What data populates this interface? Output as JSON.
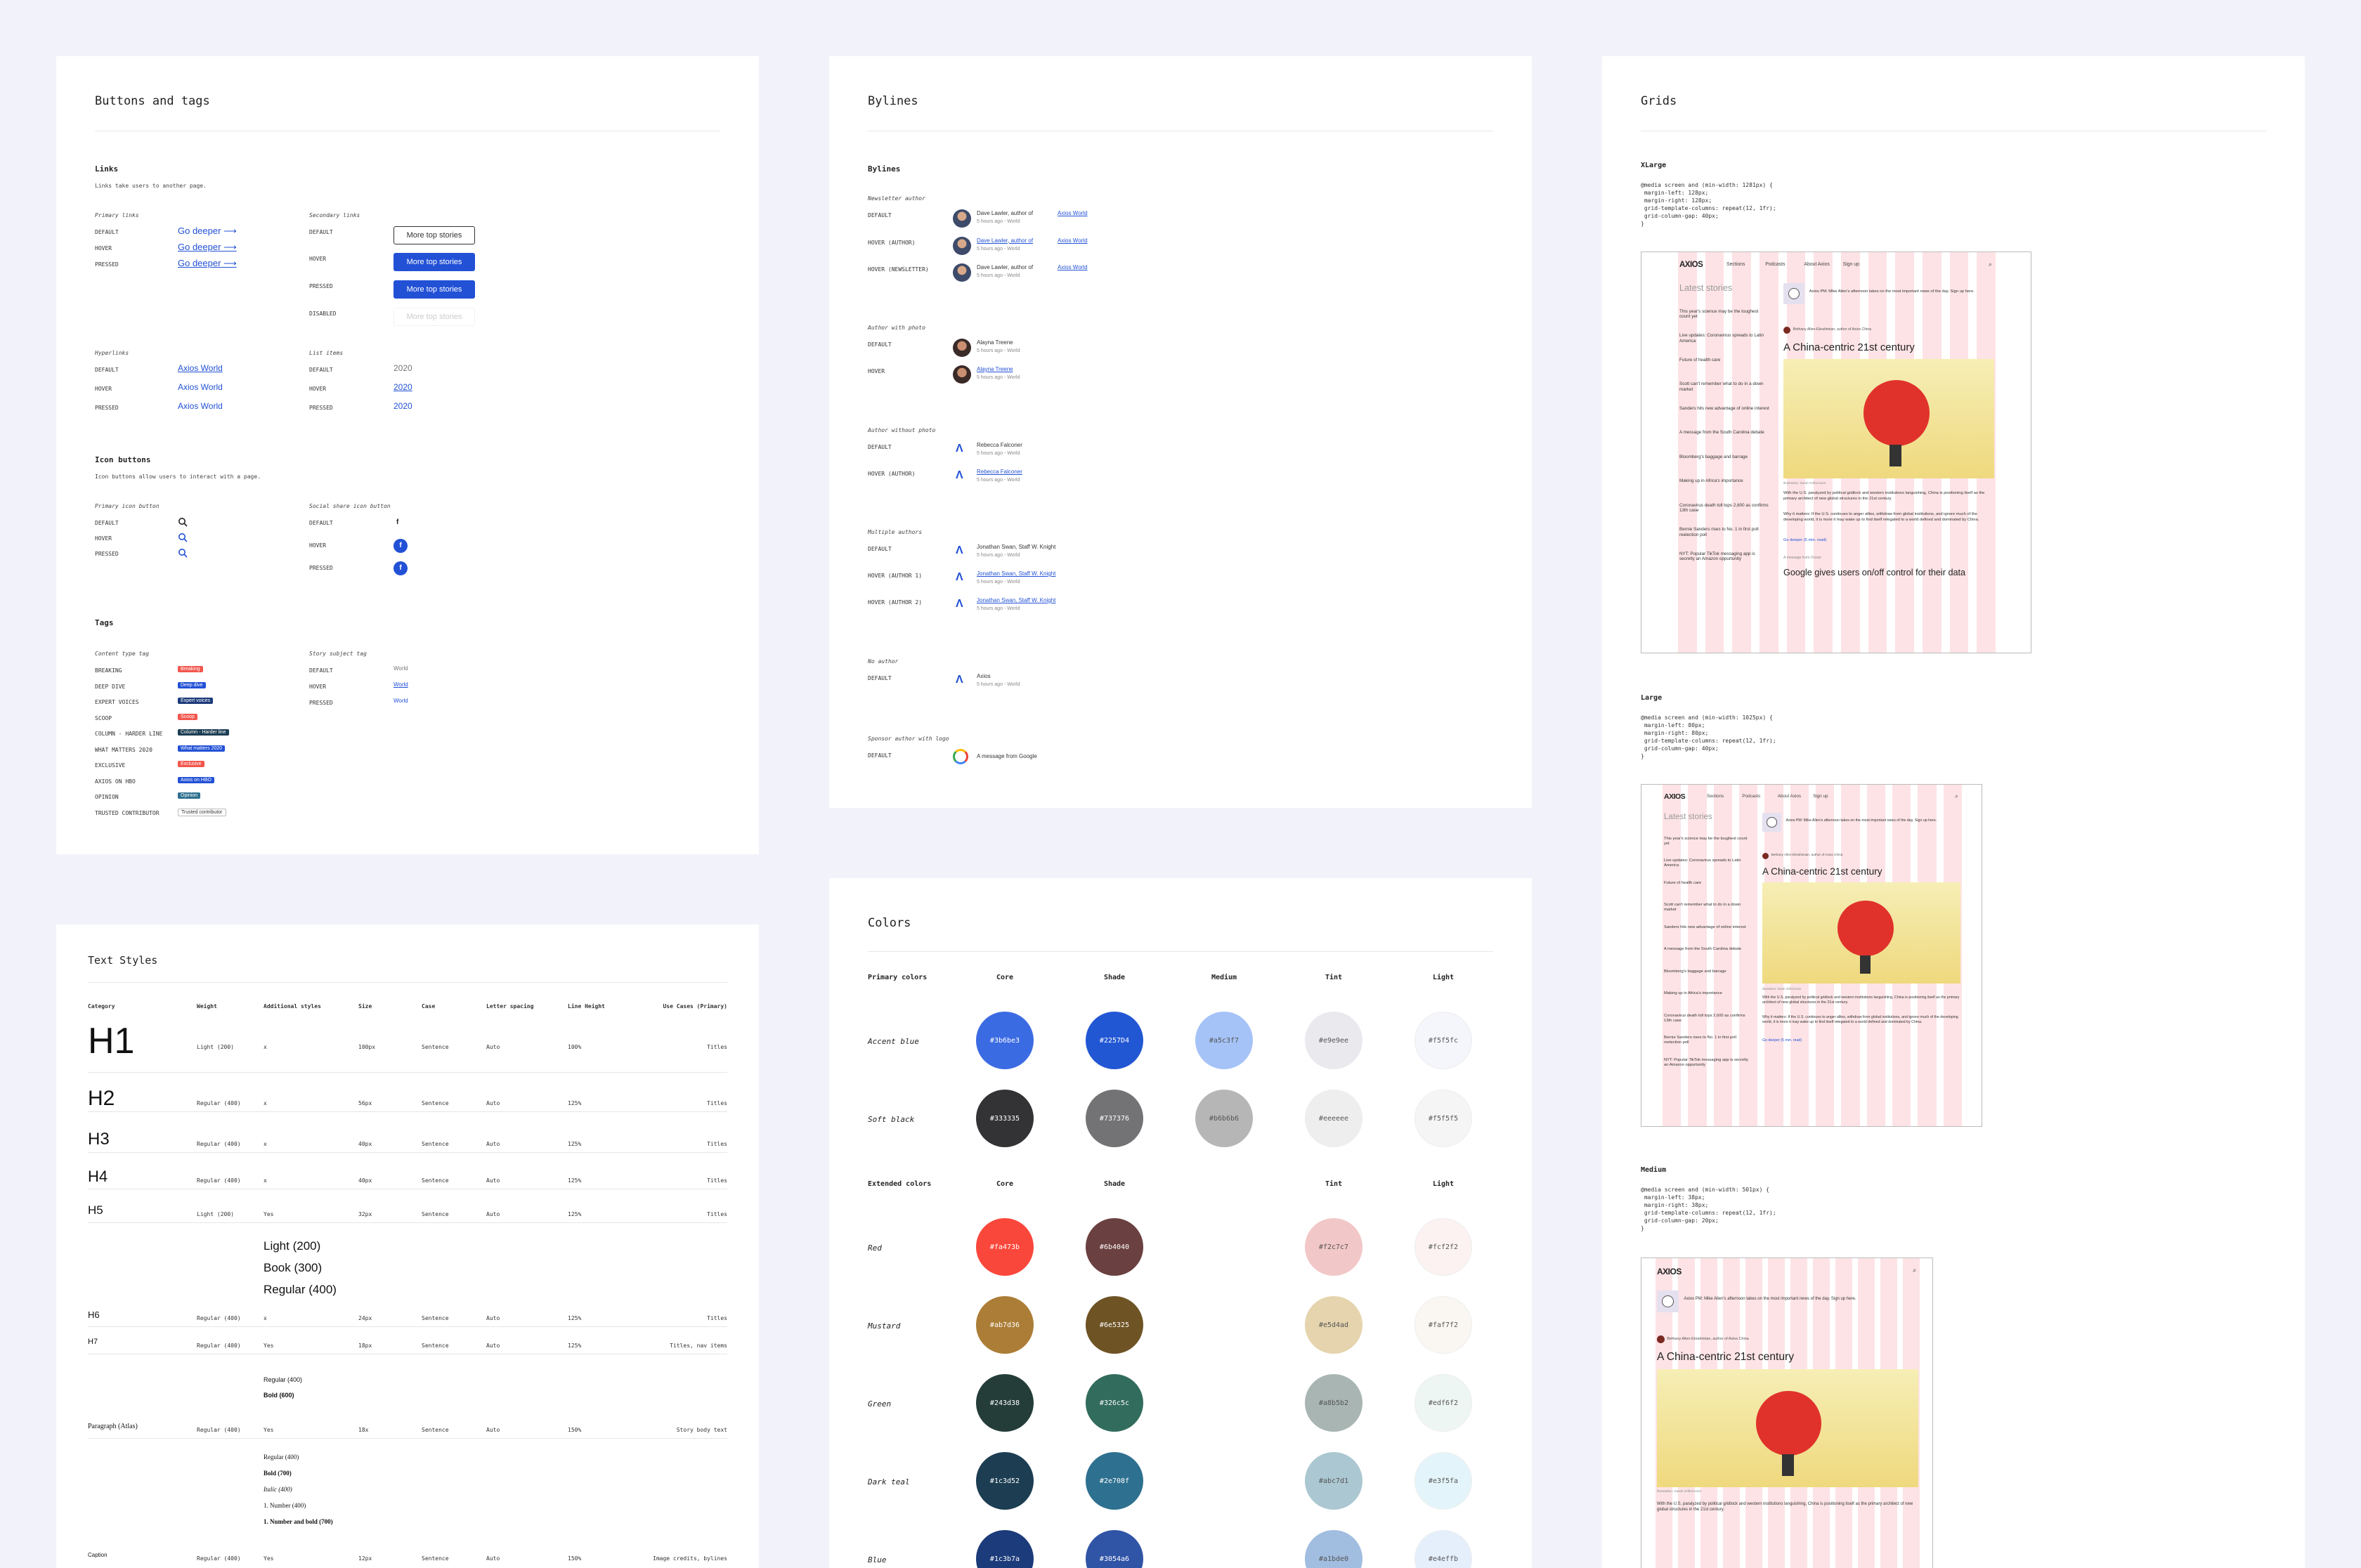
{
  "buttons_tags": {
    "title": "Buttons and tags",
    "links": {
      "heading": "Links",
      "desc": "Links take users to another page.",
      "primary": {
        "heading": "Primary links",
        "link_text": "Go deeper",
        "states": [
          "DEFAULT",
          "HOVER",
          "PRESSED"
        ]
      },
      "secondary": {
        "heading": "Secondary links",
        "button_text": "More top stories",
        "states": [
          "DEFAULT",
          "HOVER",
          "PRESSED",
          "DISABLED"
        ]
      },
      "hyper": {
        "heading": "Hyperlinks",
        "link_text": "Axios World",
        "states": [
          "DEFAULT",
          "HOVER",
          "PRESSED"
        ]
      },
      "list": {
        "heading": "List items",
        "text": "2020",
        "states": [
          "DEFAULT",
          "HOVER",
          "PRESSED"
        ]
      }
    },
    "icon_buttons": {
      "heading": "Icon buttons",
      "desc": "Icon buttons allow users to interact with a page.",
      "primary": {
        "heading": "Primary icon button",
        "states": [
          "DEFAULT",
          "HOVER",
          "PRESSED"
        ]
      },
      "social": {
        "heading": "Social share icon button",
        "states": [
          "DEFAULT",
          "HOVER",
          "PRESSED"
        ]
      }
    },
    "tags": {
      "heading": "Tags",
      "content_type": {
        "heading": "Content type tag",
        "items": [
          {
            "label": "BREAKING",
            "tag": "Breaking",
            "color": "#f2564d"
          },
          {
            "label": "DEEP DIVE",
            "tag": "Deep dive",
            "color": "#2251d6"
          },
          {
            "label": "EXPERT VOICES",
            "tag": "Expert voices",
            "color": "#1c3b7a"
          },
          {
            "label": "SCOOP",
            "tag": "Scoop",
            "color": "#f2564d"
          },
          {
            "label": "COLUMN - HARDER LINE",
            "tag": "Column - Harder line",
            "color": "#1c3d52"
          },
          {
            "label": "WHAT MATTERS 2020",
            "tag": "What matters 2020",
            "color": "#2251d6"
          },
          {
            "label": "EXCLUSIVE",
            "tag": "Exclusive",
            "color": "#f2564d"
          },
          {
            "label": "AXIOS ON HBO",
            "tag": "Axios on HBO",
            "color": "#2251d6"
          },
          {
            "label": "OPINION",
            "tag": "Opinion",
            "color": "#2e708f"
          },
          {
            "label": "TRUSTED CONTRIBUTOR",
            "tag": "Trusted contributor",
            "color": "#ffffff"
          }
        ]
      },
      "story_subject": {
        "heading": "Story subject tag",
        "text": "World",
        "states": [
          "DEFAULT",
          "HOVER",
          "PRESSED"
        ]
      }
    }
  },
  "bylines": {
    "title": "Bylines",
    "heading": "Bylines",
    "newsletter": {
      "heading": "Newsletter author",
      "name": "Dave Lawler, author of",
      "link": "Axios World",
      "meta": "5 hours ago - World",
      "states": [
        "DEFAULT",
        "HOVER (AUTHOR)",
        "HOVER (NEWSLETTER)"
      ]
    },
    "with_photo": {
      "heading": "Author with photo",
      "name": "Alayna Treene",
      "meta": "5 hours ago - World",
      "states": [
        "DEFAULT",
        "HOVER"
      ]
    },
    "without_photo": {
      "heading": "Author without photo",
      "name": "Rebecca Falconer",
      "meta": "5 hours ago - World",
      "states": [
        "DEFAULT",
        "HOVER (AUTHOR)"
      ]
    },
    "multiple": {
      "heading": "Multiple authors",
      "name": "Jonathan Swan, Staff W. Knight",
      "meta": "5 hours ago - World",
      "states": [
        "DEFAULT",
        "HOVER (AUTHOR 1)",
        "HOVER (AUTHOR 2)"
      ]
    },
    "no_author": {
      "heading": "No author",
      "name": "Axios",
      "meta": "5 hours ago - World",
      "states": [
        "DEFAULT"
      ]
    },
    "sponsor": {
      "heading": "Sponsor author with logo",
      "name": "A message from Google",
      "states": [
        "DEFAULT"
      ]
    }
  },
  "grids": {
    "title": "Grids",
    "sections": [
      {
        "heading": "XLarge",
        "code": "@media screen and (min-width: 1281px) {\n margin-left: 128px;\n margin-right: 128px;\n grid-template-columns: repeat(12, 1fr);\n grid-column-gap: 40px;\n}"
      },
      {
        "heading": "Large",
        "code": "@media screen and (min-width: 1025px) {\n margin-left: 80px;\n margin-right: 80px;\n grid-template-columns: repeat(12, 1fr);\n grid-column-gap: 40px;\n}"
      },
      {
        "heading": "Medium",
        "code": "@media screen and (min-width: 501px) {\n margin-left: 38px;\n margin-right: 38px;\n grid-template-columns: repeat(12, 1fr);\n grid-column-gap: 20px;\n}"
      }
    ],
    "mock": {
      "logo": "AXIOS",
      "nav": [
        "Sections",
        "Podcasts",
        "About Axios",
        "Sign up"
      ],
      "latest": "Latest stories",
      "stories": [
        "This year's science may be the toughest count yet",
        "Live updates: Coronavirus spreads to Latin America",
        "Future of health care",
        "Scott can't remember what to do in a down market",
        "Sanders hits new advantage of online interest",
        "A message from the South Carolina debate",
        "Bloomberg's baggage and barrage",
        "Making up in Africa's importance",
        "Coronavirus death toll tops 2,600 as confirms 13th case",
        "Bernie Sanders rises to No. 1 in first poll reelection poll",
        "NYT: Popular TikTok messaging app is secretly an Amazon oppurtunity"
      ],
      "headline": "A China-centric 21st century",
      "byline": "Bethany Allen-Ebrahimian, author of Axios China",
      "promo": "Axios PM: Mike Allen's afternoon takes on the most important news of the day. Sign up here.",
      "body": "With the U.S. paralyzed by political gridlock and western institutions languishing, China is positioning itself as the primary architect of new global structures in the 21st century.",
      "why": "Why it matters: If the U.S. continues to anger allies, withdraw from global institutions, and ignore much of the developing world, it is more it may wake up to find itself relegated to a world defined and dominated by China.",
      "deeper": "Go deeper (5 min. read)",
      "second": "Google gives users on/off control for their data",
      "illus": "Illustration: Sarah Grillo/Axios",
      "sponsor": "A message from Ocean"
    }
  },
  "text_styles": {
    "title": "Text Styles",
    "headers": [
      "Category",
      "Weight",
      "Additional styles",
      "Size",
      "Case",
      "Letter spacing",
      "Line Height",
      "Use Cases (Primary)"
    ],
    "rows": [
      {
        "cat": "H1",
        "weight": "Light (200)",
        "add": "x",
        "size": "100px",
        "case": "Sentence",
        "ls": "Auto",
        "lh": "100%",
        "use": "Titles"
      },
      {
        "cat": "H2",
        "weight": "Regular (400)",
        "add": "x",
        "size": "56px",
        "case": "Sentence",
        "ls": "Auto",
        "lh": "125%",
        "use": "Titles"
      },
      {
        "cat": "H3",
        "weight": "Regular (400)",
        "add": "x",
        "size": "40px",
        "case": "Sentence",
        "ls": "Auto",
        "lh": "125%",
        "use": "Titles"
      },
      {
        "cat": "H4",
        "weight": "Regular (400)",
        "add": "x",
        "size": "40px",
        "case": "Sentence",
        "ls": "Auto",
        "lh": "125%",
        "use": "Titles"
      },
      {
        "cat": "H5",
        "weight": "Light (200)",
        "add": "Yes",
        "size": "32px",
        "case": "Sentence",
        "ls": "Auto",
        "lh": "125%",
        "use": "Titles"
      },
      {
        "cat": "H6",
        "weight": "Regular (400)",
        "add": "x",
        "size": "24px",
        "case": "Sentence",
        "ls": "Auto",
        "lh": "125%",
        "use": "Titles"
      },
      {
        "cat": "H7",
        "weight": "Regular (400)",
        "add": "Yes",
        "size": "18px",
        "case": "Sentence",
        "ls": "Auto",
        "lh": "125%",
        "use": "Titles, nav items"
      },
      {
        "cat": "Paragraph (Atlas)",
        "weight": "Regular (400)",
        "add": "Yes",
        "size": "18x",
        "case": "Sentence",
        "ls": "Auto",
        "lh": "150%",
        "use": "Story body text"
      },
      {
        "cat": "Caption",
        "weight": "Regular (400)",
        "add": "Yes",
        "size": "12px",
        "case": "Sentence",
        "ls": "Auto",
        "lh": "150%",
        "use": "Image credits, bylines"
      }
    ],
    "h5_styles": [
      "Light (200)",
      "Book (300)",
      "Regular (400)"
    ],
    "h7_styles": [
      "Regular (400)",
      "Bold (600)"
    ],
    "para_styles": [
      "Regular (400)",
      "Bold (700)",
      "Italic (400)",
      "1. Number (400)",
      "1. Number and bold (700)"
    ]
  },
  "colors": {
    "title": "Colors",
    "primary": {
      "heading": "Primary colors",
      "cols": [
        "Core",
        "Shade",
        "Medium",
        "Tint",
        "Light"
      ],
      "rows": [
        {
          "name": "Accent blue",
          "swatches": [
            "#3b6be3",
            "#2257D4",
            "#a5c3f7",
            "#e9e9ee",
            "#f5f5fc"
          ]
        },
        {
          "name": "Soft black",
          "swatches": [
            "#333335",
            "#737376",
            "#b6b6b6",
            "#eeeeee",
            "#f5f5f5"
          ]
        }
      ]
    },
    "extended": {
      "heading": "Extended colors",
      "cols": [
        "Core",
        "Shade",
        "Tint",
        "Light"
      ],
      "rows": [
        {
          "name": "Red",
          "swatches": [
            "#fa473b",
            "#6b4040",
            "#f2c7c7",
            "#fcf2f2"
          ]
        },
        {
          "name": "Mustard",
          "swatches": [
            "#ab7d36",
            "#6e5325",
            "#e5d4ad",
            "#faf7f2"
          ]
        },
        {
          "name": "Green",
          "swatches": [
            "#243d38",
            "#326c5c",
            "#a8b5b2",
            "#edf6f2"
          ]
        },
        {
          "name": "Dark teal",
          "swatches": [
            "#1c3d52",
            "#2e708f",
            "#abc7d1",
            "#e3f5fa"
          ]
        },
        {
          "name": "Blue",
          "swatches": [
            "#1c3b7a",
            "#3054a6",
            "#a1bde0",
            "#e4effb"
          ]
        }
      ]
    }
  }
}
